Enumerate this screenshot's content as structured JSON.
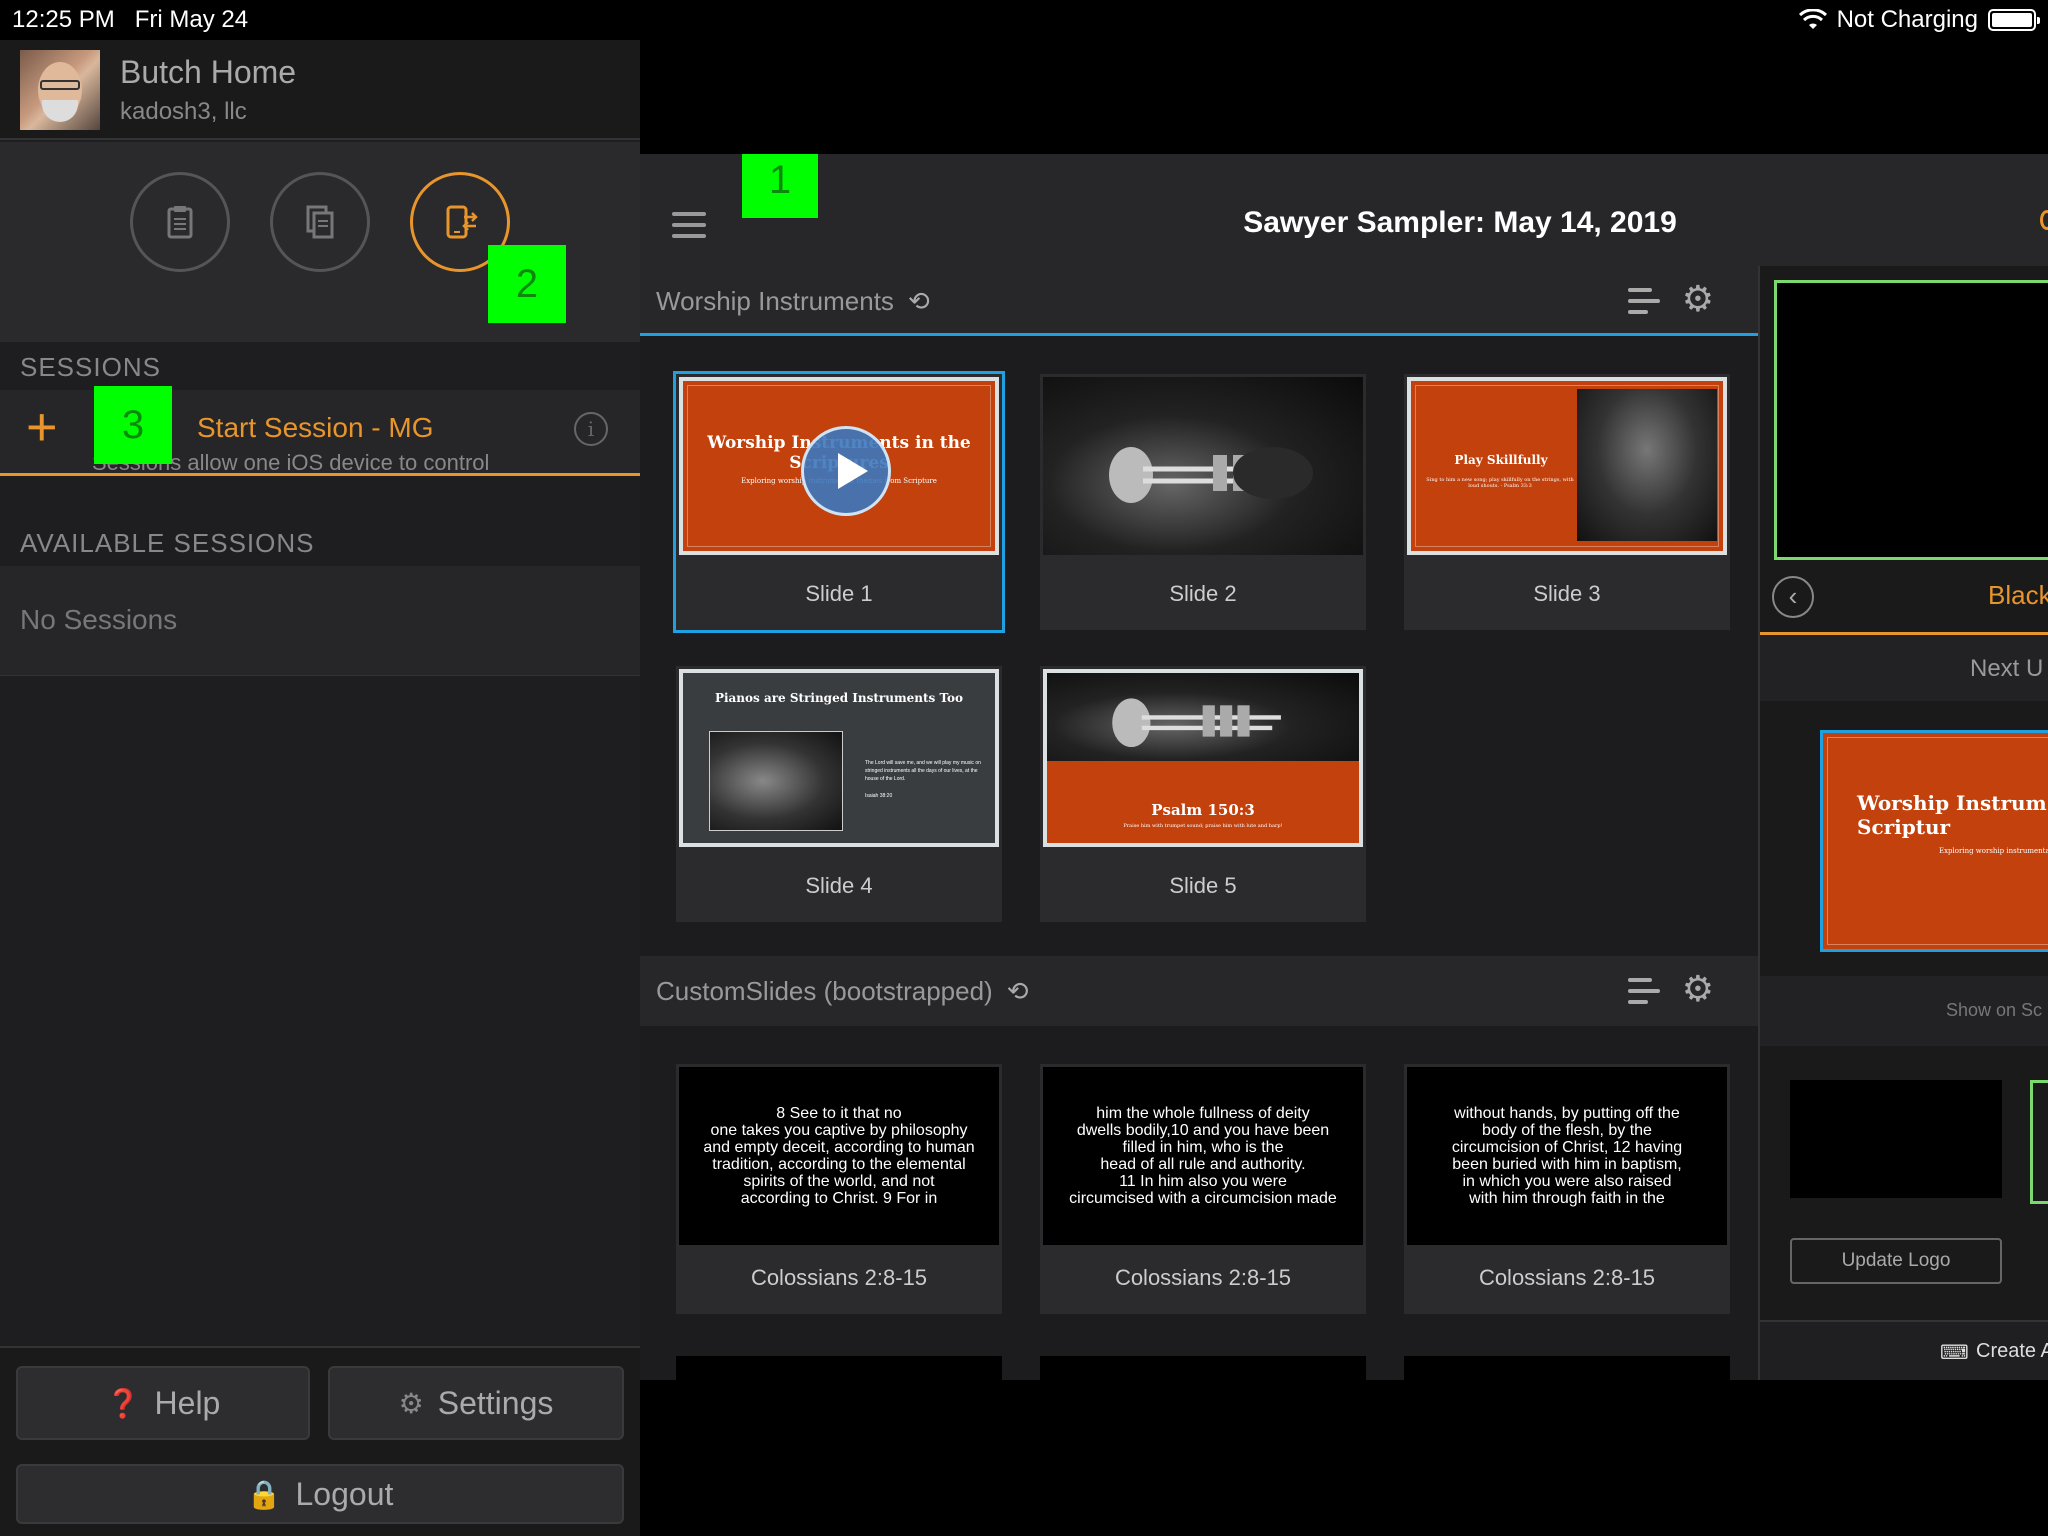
{
  "status_bar": {
    "time": "12:25 PM",
    "date": "Fri May 24",
    "charging": "Not Charging"
  },
  "profile": {
    "name": "Butch Home",
    "org": "kadosh3, llc"
  },
  "markers": [
    "1",
    "2",
    "3"
  ],
  "sessions": {
    "label": "SESSIONS",
    "start_title": "Start Session - MG",
    "start_sub": "Sessions allow one iOS device to control",
    "available_label": "AVAILABLE SESSIONS",
    "empty": "No Sessions"
  },
  "footer": {
    "help": "Help",
    "settings": "Settings",
    "logout": "Logout"
  },
  "main": {
    "title": "Sawyer Sampler: May 14, 2019"
  },
  "section1": {
    "title": "Worship Instruments",
    "slides": [
      {
        "label": "Slide 1",
        "text": "Worship Instruments in the Scriptures",
        "sub": "Exploring worship instrumental themes from Scripture"
      },
      {
        "label": "Slide 2"
      },
      {
        "label": "Slide 3",
        "text": "Play Skillfully",
        "sub": "Sing to him a new song; play skillfully on the strings, with loud shouts. - Psalm 33:3"
      },
      {
        "label": "Slide 4",
        "text": "Pianos are Stringed Instruments Too",
        "sub": "The Lord will save me, and we will play my music on stringed instruments all the days of our lives, at the house of the Lord.",
        "ref": "Isaiah 38:20"
      },
      {
        "label": "Slide 5",
        "text": "Psalm 150:3",
        "sub": "Praise him with trumpet sound; praise him with lute and harp!"
      }
    ]
  },
  "section2": {
    "title": "CustomSlides (bootstrapped)",
    "slides": [
      {
        "label": "Colossians 2:8-15",
        "text": "8 See to it that no\none takes you captive by philosophy\nand empty deceit, according to human\ntradition, according to the elemental\nspirits of the world, and not\naccording to Christ. 9 For in"
      },
      {
        "label": "Colossians 2:8-15",
        "text": "him the whole fullness of deity\ndwells bodily,10 and you have been\nfilled in him, who is the\nhead of all rule and authority.\n11 In him also you were\ncircumcised with a circumcision made"
      },
      {
        "label": "Colossians 2:8-15",
        "text": "without hands, by putting off the\nbody of the flesh, by the\ncircumcision of Christ, 12 having\nbeen buried with him in baptism,\nin which you were also raised\nwith him through faith in the"
      }
    ]
  },
  "right_panel": {
    "black": "Black",
    "next_up": "Next U",
    "next_title": "Worship Instrum Scriptur",
    "next_sub": "Exploring worship instrumental themes",
    "show_on": "Show on Sc",
    "update_logo": "Update Logo",
    "create": "Create A"
  },
  "colors": {
    "accent": "#e8952b",
    "selected": "#1fa0e0",
    "slide_orange": "#c2410c",
    "marker": "#00ff00"
  }
}
